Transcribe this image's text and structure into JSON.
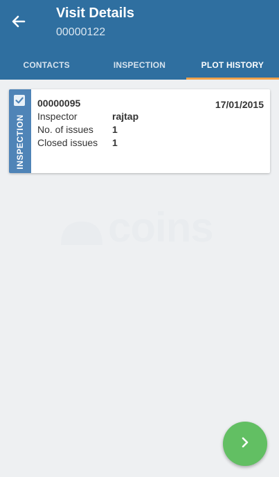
{
  "header": {
    "title": "Visit Details",
    "subtitle": "00000122"
  },
  "tabs": [
    {
      "label": "CONTACTS",
      "active": false
    },
    {
      "label": "INSPECTION",
      "active": false
    },
    {
      "label": "PLOT HISTORY",
      "active": true
    }
  ],
  "card": {
    "type_label": "INSPECTION",
    "code": "00000095",
    "date": "17/01/2015",
    "rows": [
      {
        "label": "Inspector",
        "value": "rajtap"
      },
      {
        "label": "No. of issues",
        "value": "1"
      },
      {
        "label": "Closed issues",
        "value": "1"
      }
    ]
  },
  "watermark": {
    "text": "coins"
  },
  "colors": {
    "header": "#2f6fa0",
    "tab_indicator": "#f0a24b",
    "card_stripe": "#4f84b7",
    "fab": "#62bf63"
  },
  "icons": {
    "back": "arrow-left-icon",
    "checkbox": "checkbox-checked-icon",
    "fab": "chevron-right-icon"
  }
}
